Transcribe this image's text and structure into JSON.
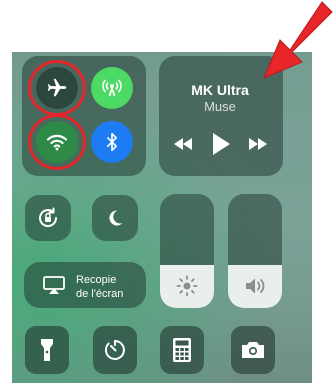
{
  "now_playing": {
    "title": "MK Ultra",
    "artist": "Muse",
    "state": "paused"
  },
  "screen_mirroring": {
    "label_line1": "Recopie",
    "label_line2": "de l'écran"
  },
  "toggles": {
    "airplane_mode": true,
    "cellular_data": true,
    "wifi": true,
    "bluetooth": true,
    "rotation_lock": false,
    "do_not_disturb": false
  },
  "sliders": {
    "brightness_level": 0.38,
    "volume_level": 0.38
  },
  "icons": {
    "airplane": "airplane-icon",
    "cellular": "antenna-icon",
    "wifi": "wifi-icon",
    "bluetooth": "bluetooth-icon",
    "rotation_lock": "rotation-lock-icon",
    "do_not_disturb": "moon-icon",
    "mirroring": "airplay-icon",
    "brightness": "sun-icon",
    "volume": "speaker-icon",
    "flashlight": "flashlight-icon",
    "timer": "timer-icon",
    "calculator": "calculator-icon",
    "camera": "camera-icon"
  },
  "colors": {
    "airplane_on": "#f2a33a",
    "cellular_on": "#4cd964",
    "wifi_on": "#1e7cf2",
    "bluetooth_on": "#1e7cf2",
    "annotation_red": "#e8262a"
  }
}
